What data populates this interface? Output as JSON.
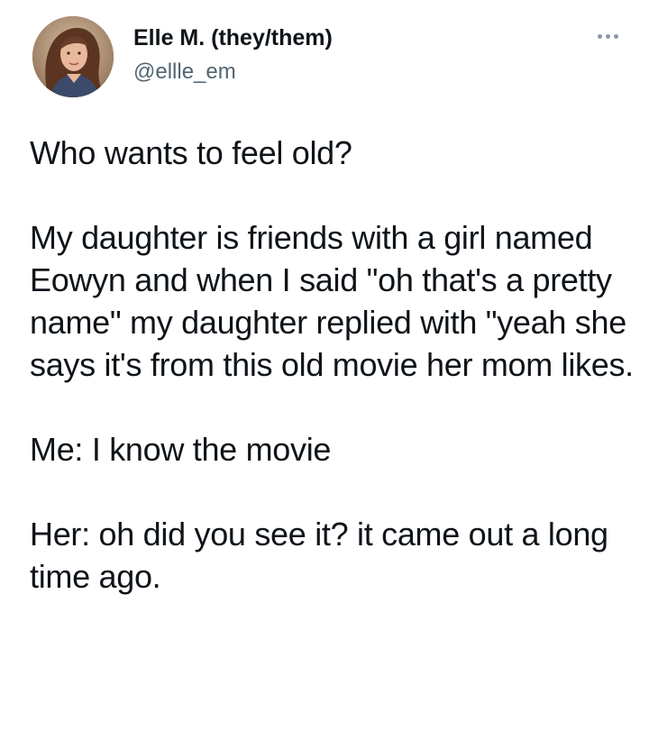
{
  "tweet": {
    "author": {
      "display_name": "Elle M. (they/them)",
      "handle": "@ellle_em",
      "avatar_icon": "profile-photo"
    },
    "more_icon": "more-horizontal-icon",
    "paragraphs": [
      "Who wants to feel old?",
      "My daughter is friends with a girl named Eowyn and when I said \"oh that's a pretty name\" my daughter replied with \"yeah she says it's from this old movie her mom likes.",
      "Me: I know the movie",
      "Her: oh did you see it? it came out a long time ago."
    ]
  }
}
